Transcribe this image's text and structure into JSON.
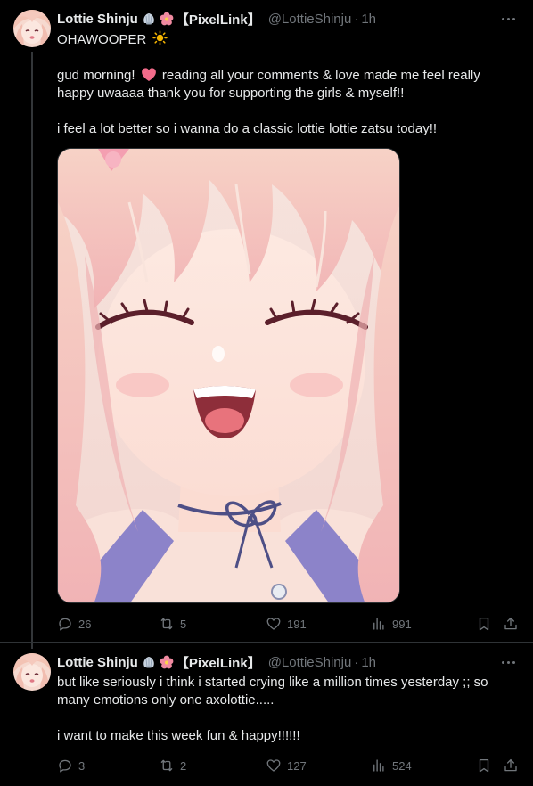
{
  "tweets": [
    {
      "author": {
        "name": "Lottie Shinju",
        "org_tag": "【PixelLink】",
        "handle": "@LottieShinju",
        "time": "1h",
        "badges": [
          "shell-emoji",
          "hibiscus-emoji"
        ]
      },
      "lines": [
        "OHAWOOPER",
        "",
        "gud morning!",
        "reading all your comments & love made me feel really",
        "happy uwaaaa thank you for supporting the girls & myself!!",
        "",
        "i feel a lot better so i wanna do a classic lottie lottie zatsu today!!"
      ],
      "has_image": true,
      "stats": {
        "replies": "26",
        "retweets": "5",
        "likes": "191",
        "views": "991"
      }
    },
    {
      "author": {
        "name": "Lottie Shinju",
        "org_tag": "【PixelLink】",
        "handle": "@LottieShinju",
        "time": "1h",
        "badges": [
          "shell-emoji",
          "hibiscus-emoji"
        ]
      },
      "lines": [
        "but like seriously i think i started crying like a million times yesterday ;; so",
        "many emotions only one axolottie.....",
        "",
        "i want to make this week fun & happy!!!!!!"
      ],
      "has_image": false,
      "stats": {
        "replies": "3",
        "retweets": "2",
        "likes": "127",
        "views": "524"
      }
    }
  ],
  "icons": {
    "reply": "reply-icon",
    "retweet": "retweet-icon",
    "like": "heart-icon",
    "views": "views-icon",
    "bookmark": "bookmark-icon",
    "share": "share-icon",
    "more": "more-icon"
  },
  "colors": {
    "background": "#000000",
    "text": "#e7e9ea",
    "muted": "#71767b",
    "divider": "#2f3336"
  }
}
